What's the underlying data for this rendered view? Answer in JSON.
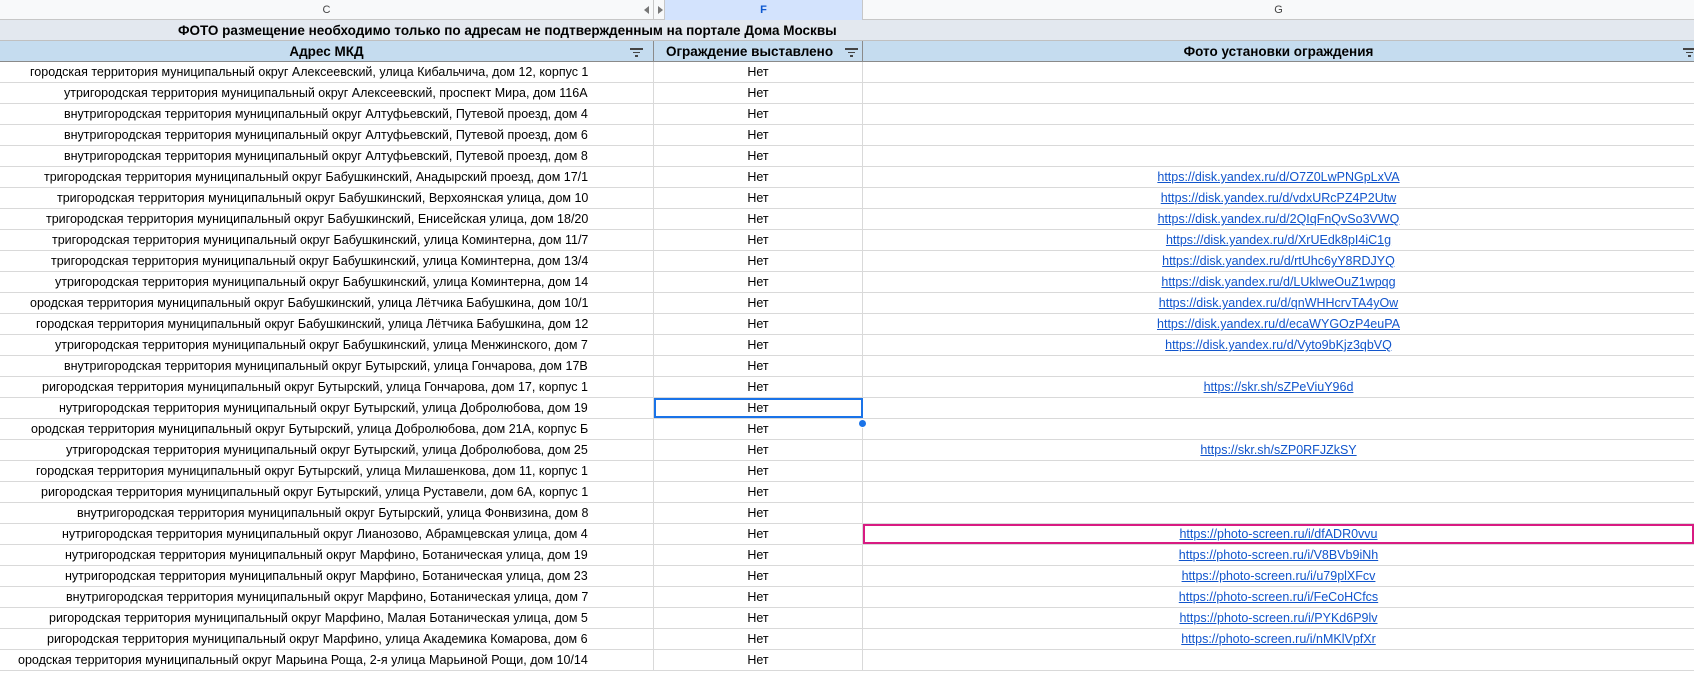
{
  "column_letters": {
    "c": "C",
    "f": "F",
    "g": "G"
  },
  "title": "ФОТО размещение необходимо только по адресам не подтвержденным на портале Дома Москвы",
  "headers": {
    "address": "Адрес МКД",
    "fence": "Ограждение выставлено",
    "photo": "Фото установки ограждения"
  },
  "rows": [
    {
      "address": "городская территория муниципальный округ Алексеевский, улица Кибальчича, дом 12, корпус 1",
      "fence": "Нет",
      "photo": ""
    },
    {
      "address": "утригородская территория муниципальный округ Алексеевский, проспект Мира, дом 116А",
      "fence": "Нет",
      "photo": ""
    },
    {
      "address": "внутригородская территория муниципальный округ Алтуфьевский, Путевой проезд, дом 4",
      "fence": "Нет",
      "photo": ""
    },
    {
      "address": "внутригородская территория муниципальный округ Алтуфьевский, Путевой проезд, дом 6",
      "fence": "Нет",
      "photo": ""
    },
    {
      "address": "внутригородская территория муниципальный округ Алтуфьевский, Путевой проезд, дом 8",
      "fence": "Нет",
      "photo": ""
    },
    {
      "address": "тригородская территория муниципальный округ Бабушкинский, Анадырский проезд, дом 17/1",
      "fence": "Нет",
      "photo": "https://disk.yandex.ru/d/O7Z0LwPNGpLxVA"
    },
    {
      "address": "тригородская территория муниципальный округ Бабушкинский, Верхоянская улица, дом 10",
      "fence": "Нет",
      "photo": "https://disk.yandex.ru/d/vdxURcPZ4P2Utw"
    },
    {
      "address": "тригородская территория муниципальный округ Бабушкинский, Енисейская улица, дом 18/20",
      "fence": "Нет",
      "photo": "https://disk.yandex.ru/d/2QIqFnQvSo3VWQ"
    },
    {
      "address": "тригородская территория муниципальный округ Бабушкинский, улица Коминтерна, дом 11/7",
      "fence": "Нет",
      "photo": "https://disk.yandex.ru/d/XrUEdk8pI4iC1g"
    },
    {
      "address": "тригородская территория муниципальный округ Бабушкинский, улица Коминтерна, дом 13/4",
      "fence": "Нет",
      "photo": "https://disk.yandex.ru/d/rtUhc6yY8RDJYQ"
    },
    {
      "address": "утригородская территория муниципальный округ Бабушкинский, улица Коминтерна, дом 14",
      "fence": "Нет",
      "photo": "https://disk.yandex.ru/d/LUklweOuZ1wpqg"
    },
    {
      "address": "ородская территория муниципальный округ Бабушкинский, улица Лётчика Бабушкина, дом 10/1",
      "fence": "Нет",
      "photo": "https://disk.yandex.ru/d/qnWHHcrvTA4yOw"
    },
    {
      "address": "городская территория муниципальный округ Бабушкинский, улица Лётчика Бабушкина, дом 12",
      "fence": "Нет",
      "photo": "https://disk.yandex.ru/d/ecaWYGOzP4euPA"
    },
    {
      "address": "утригородская территория муниципальный округ Бабушкинский, улица Менжинского, дом 7",
      "fence": "Нет",
      "photo": "https://disk.yandex.ru/d/Vyto9bKjz3qbVQ"
    },
    {
      "address": "внутригородская территория муниципальный округ Бутырский, улица Гончарова, дом 17В",
      "fence": "Нет",
      "photo": ""
    },
    {
      "address": "ригородская территория муниципальный округ Бутырский, улица Гончарова, дом 17, корпус 1",
      "fence": "Нет",
      "photo": "https://skr.sh/sZPeViuY96d"
    },
    {
      "address": "нутригородская территория муниципальный округ Бутырский, улица Добролюбова, дом 19",
      "fence": "Нет",
      "photo": ""
    },
    {
      "address": "ородская территория муниципальный округ Бутырский, улица Добролюбова, дом 21А, корпус Б",
      "fence": "Нет",
      "photo": ""
    },
    {
      "address": "утригородская территория муниципальный округ Бутырский, улица Добролюбова, дом 25",
      "fence": "Нет",
      "photo": "https://skr.sh/sZP0RFJZkSY"
    },
    {
      "address": "городская территория муниципальный округ Бутырский, улица Милашенкова, дом 11, корпус 1",
      "fence": "Нет",
      "photo": ""
    },
    {
      "address": "ригородская территория муниципальный округ Бутырский, улица Руставели, дом 6А, корпус 1",
      "fence": "Нет",
      "photo": ""
    },
    {
      "address": "внутригородская территория муниципальный округ Бутырский, улица Фонвизина, дом 8",
      "fence": "Нет",
      "photo": ""
    },
    {
      "address": "нутригородская территория муниципальный округ Лианозово, Абрамцевская улица, дом 4",
      "fence": "Нет",
      "photo": "https://photo-screen.ru/i/dfADR0vvu"
    },
    {
      "address": "нутригородская территория муниципальный округ Марфино, Ботаническая улица, дом 19",
      "fence": "Нет",
      "photo": "https://photo-screen.ru/i/V8BVb9iNh"
    },
    {
      "address": "нутригородская территория муниципальный округ Марфино, Ботаническая улица, дом 23",
      "fence": "Нет",
      "photo": "https://photo-screen.ru/i/u79plXFcv"
    },
    {
      "address": "внутригородская территория муниципальный округ Марфино, Ботаническая улица, дом 7",
      "fence": "Нет",
      "photo": "https://photo-screen.ru/i/FeCoHCfcs"
    },
    {
      "address": "ригородская территория муниципальный округ Марфино, Малая Ботаническая улица, дом 5",
      "fence": "Нет",
      "photo": "https://photo-screen.ru/i/PYKd6P9lv"
    },
    {
      "address": "ригородская территория муниципальный округ Марфино, улица Академика Комарова, дом 6",
      "fence": "Нет",
      "photo": "https://photo-screen.ru/i/nMKlVpfXr"
    },
    {
      "address": "ородская территория муниципальный округ Марьина Роща, 2-я улица Марьиной Рощи, дом 10/14",
      "fence": "Нет",
      "photo": ""
    }
  ]
}
